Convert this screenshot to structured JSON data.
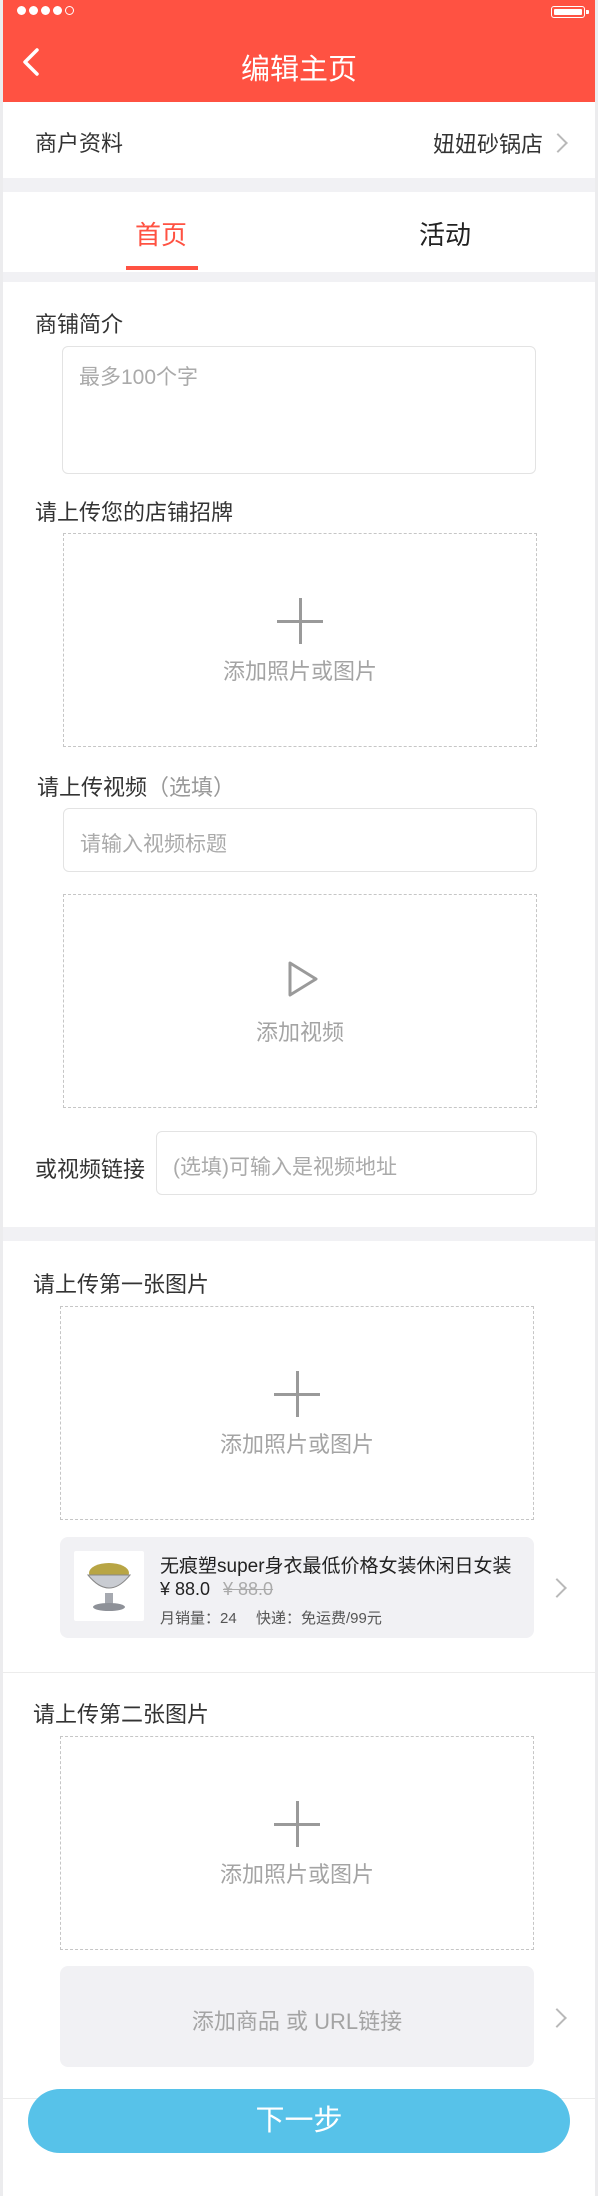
{
  "header": {
    "title": "编辑主页"
  },
  "merchant": {
    "label": "商户资料",
    "value": "妞妞砂锅店"
  },
  "tabs": [
    {
      "label": "首页",
      "active": true
    },
    {
      "label": "活动",
      "active": false
    }
  ],
  "intro": {
    "label": "商铺简介",
    "placeholder": "最多100个字"
  },
  "signboard": {
    "label": "请上传您的店铺招牌",
    "upload_caption": "添加照片或图片"
  },
  "video": {
    "label": "请上传视频",
    "optional": "（选填）",
    "title_placeholder": "请输入视频标题",
    "upload_caption": "添加视频",
    "link_label": "或视频链接",
    "link_placeholder": "(选填)可输入是视频地址"
  },
  "image1": {
    "label": "请上传第一张图片",
    "upload_caption": "添加照片或图片",
    "product": {
      "name": "无痕塑super身衣最低价格女装休闲日女装",
      "price": "¥ 88.0",
      "original_price": "¥ 88.0",
      "sales": "月销量：24",
      "shipping": "快递：免运费/99元"
    }
  },
  "image2": {
    "label": "请上传第二张图片",
    "upload_caption": "添加照片或图片",
    "add_product": "添加商品 或 URL链接"
  },
  "next_button": "下一步",
  "colors": {
    "brand": "#ff5242",
    "button": "#57c2e9"
  }
}
